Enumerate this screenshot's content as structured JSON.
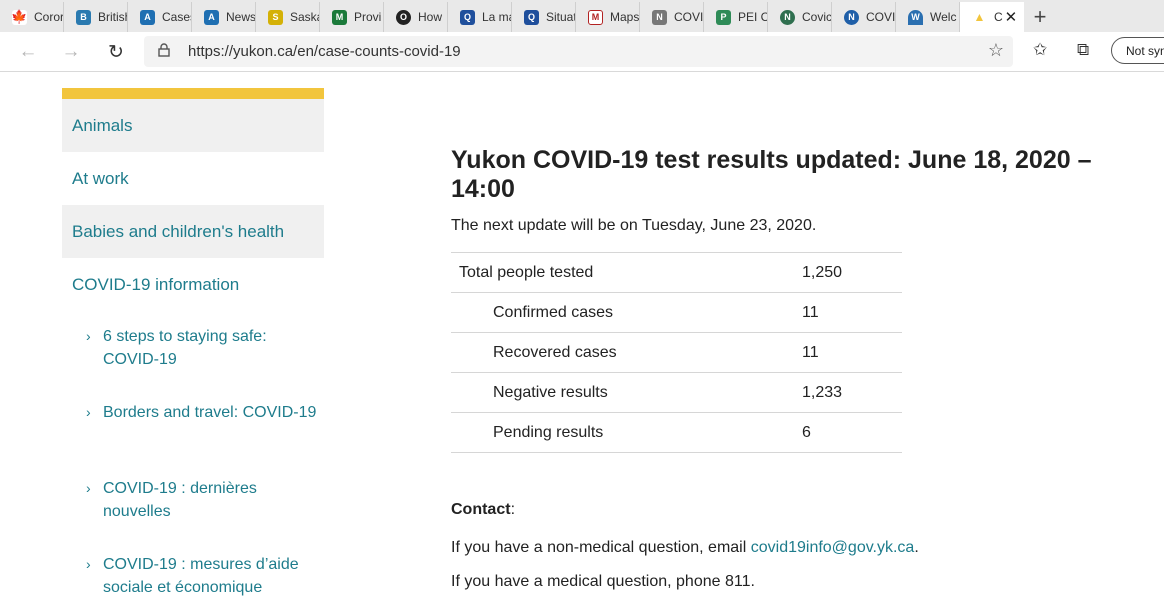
{
  "browser": {
    "tabs": [
      {
        "label": "Coror",
        "icon": "maple-leaf-icon",
        "color": "#d52b1e"
      },
      {
        "label": "British",
        "icon": "bc-icon",
        "color": "#2a7ab0"
      },
      {
        "label": "Cases",
        "icon": "alberta-icon",
        "color": "#1f6fb2"
      },
      {
        "label": "News",
        "icon": "alberta-icon",
        "color": "#1f6fb2"
      },
      {
        "label": "Saska",
        "icon": "saskatchewan-icon",
        "color": "#d4b106"
      },
      {
        "label": "Provi",
        "icon": "manitoba-icon",
        "color": "#1b7a3a"
      },
      {
        "label": "How",
        "icon": "ontario-icon",
        "color": "#222222"
      },
      {
        "label": "La ma",
        "icon": "quebec-icon",
        "color": "#1f4f9c"
      },
      {
        "label": "Situat",
        "icon": "quebec-icon",
        "color": "#1f4f9c"
      },
      {
        "label": "Maps",
        "icon": "maps-icon",
        "color": "#b22222"
      },
      {
        "label": "COVI",
        "icon": "nb-icon",
        "color": "#777777"
      },
      {
        "label": "PEI C",
        "icon": "pei-icon",
        "color": "#2e8b57"
      },
      {
        "label": "Covic",
        "icon": "ns-icon",
        "color": "#2f6f4f"
      },
      {
        "label": "COVI",
        "icon": "nl-icon",
        "color": "#1f5fa8"
      },
      {
        "label": "Welc",
        "icon": "nwt-icon",
        "color": "#2a6fb0"
      },
      {
        "label": "C",
        "icon": "yukon-icon",
        "color": "#f2c53d"
      }
    ],
    "url": "https://yukon.ca/en/case-counts-covid-19",
    "sync_label": "Not syn"
  },
  "sidebar": {
    "accent_color": "#f2c53d",
    "items": [
      {
        "label": "Animals"
      },
      {
        "label": "At work"
      },
      {
        "label": "Babies and children's health"
      },
      {
        "label": "COVID-19 information"
      }
    ],
    "sub_items": [
      {
        "label": "6 steps to staying safe: COVID-19"
      },
      {
        "label": "Borders and travel: COVID-19"
      },
      {
        "label": "COVID-19 : dernières nouvelles"
      },
      {
        "label": "COVID-19 : mesures d’aide sociale et économique"
      }
    ]
  },
  "main": {
    "title": "Yukon COVID-19 test results updated: June 18, 2020 – 14:00",
    "next_update": "The next update will be on Tuesday, June 23, 2020.",
    "results": [
      {
        "label": "Total people tested",
        "value": "1,250"
      },
      {
        "label": "Confirmed cases",
        "value": "11"
      },
      {
        "label": "Recovered cases",
        "value": "11"
      },
      {
        "label": "Negative results",
        "value": "1,233"
      },
      {
        "label": "Pending results",
        "value": "6"
      }
    ],
    "contact": {
      "heading": "Contact",
      "colon": ":",
      "line1_prefix": "If you have a non-medical question, email ",
      "email": "covid19info@gov.yk.ca",
      "line1_suffix": ".",
      "line2": "If you have a medical question, phone 811."
    },
    "link_color": "#1e7c8c"
  }
}
